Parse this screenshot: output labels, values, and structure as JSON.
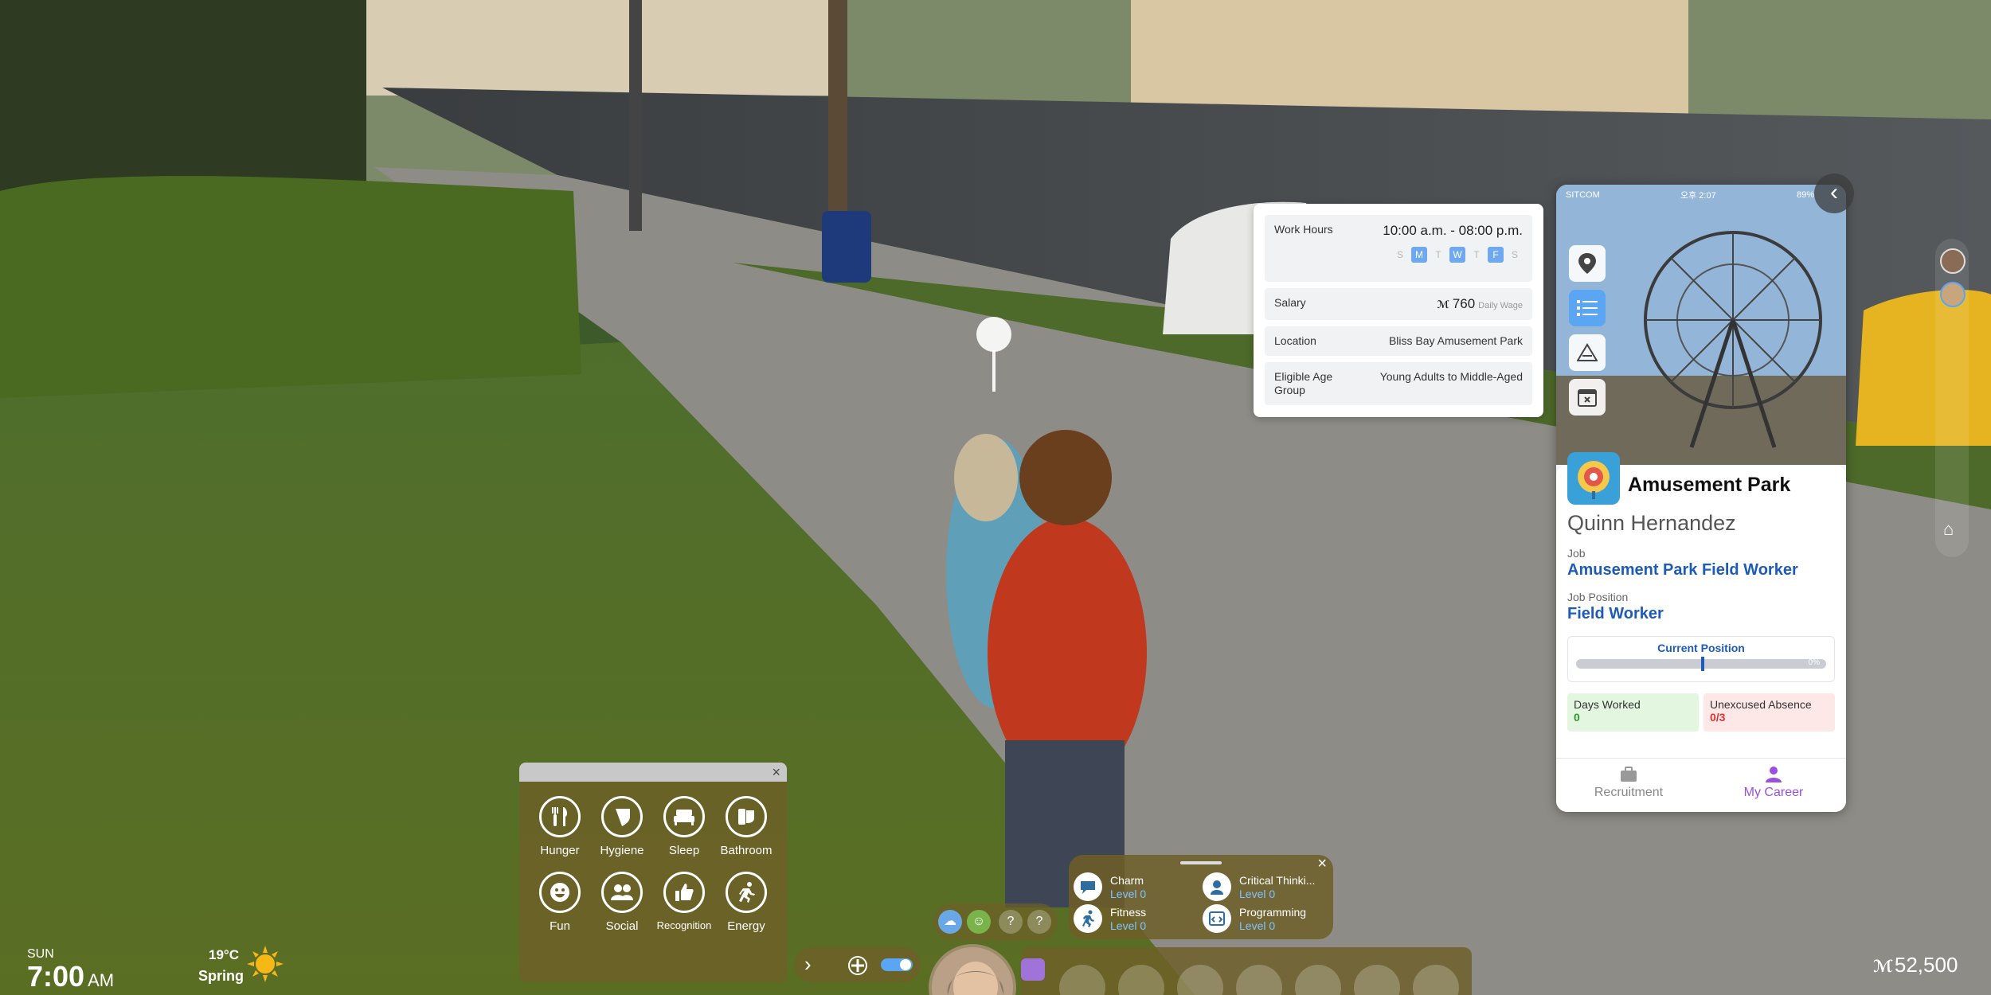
{
  "work_card": {
    "hours_label": "Work Hours",
    "hours_value": "10:00 a.m. - 08:00 p.m.",
    "days": [
      {
        "letter": "S",
        "active": false
      },
      {
        "letter": "M",
        "active": true
      },
      {
        "letter": "T",
        "active": false
      },
      {
        "letter": "W",
        "active": true
      },
      {
        "letter": "T",
        "active": false
      },
      {
        "letter": "F",
        "active": true
      },
      {
        "letter": "S",
        "active": false
      }
    ],
    "salary_label": "Salary",
    "salary_value": "760",
    "salary_unit": "Daily Wage",
    "location_label": "Location",
    "location_value": "Bliss Bay Amusement Park",
    "age_label": "Eligible Age Group",
    "age_value": "Young Adults to Middle-Aged"
  },
  "phone": {
    "carrier": "SITCOM",
    "time": "오후 2:07",
    "battery": "89%",
    "park_title": "Amusement Park",
    "person_name": "Quinn Hernandez",
    "job_label": "Job",
    "job_value": "Amusement Park Field Worker",
    "position_label": "Job Position",
    "position_value": "Field Worker",
    "current_position_label": "Current Position",
    "progress_percent": 0,
    "progress_text": "0%",
    "days_worked_label": "Days Worked",
    "days_worked_value": "0",
    "absence_label": "Unexcused Absence",
    "absence_value": "0/3",
    "nav": [
      {
        "label": "Recruitment",
        "icon": "briefcase-icon",
        "active": false
      },
      {
        "label": "My Career",
        "icon": "person-icon",
        "active": true
      }
    ]
  },
  "needs": [
    {
      "label": "Hunger",
      "icon": "fork-knife-icon"
    },
    {
      "label": "Hygiene",
      "icon": "droplet-icon"
    },
    {
      "label": "Sleep",
      "icon": "bed-icon"
    },
    {
      "label": "Bathroom",
      "icon": "toilet-icon"
    },
    {
      "label": "Fun",
      "icon": "smile-icon"
    },
    {
      "label": "Social",
      "icon": "people-icon"
    },
    {
      "label": "Recognition",
      "icon": "thumbs-up-icon"
    },
    {
      "label": "Energy",
      "icon": "runner-icon"
    }
  ],
  "clock": {
    "day": "SUN",
    "time": "7:00",
    "ampm": "AM",
    "temperature": "19°C",
    "season": "Spring"
  },
  "skills": [
    {
      "name": "Charm",
      "level": "Level 0"
    },
    {
      "name": "Critical Thinki...",
      "level": "Level 0"
    },
    {
      "name": "Fitness",
      "level": "Level 0"
    },
    {
      "name": "Programming",
      "level": "Level 0"
    }
  ],
  "money": "52,500",
  "colors": {
    "accent_blue": "#1d5bb8",
    "active_day": "#6ea9f0",
    "nav_active": "#9a4fe0",
    "hud_panel": "#6e5f28"
  }
}
